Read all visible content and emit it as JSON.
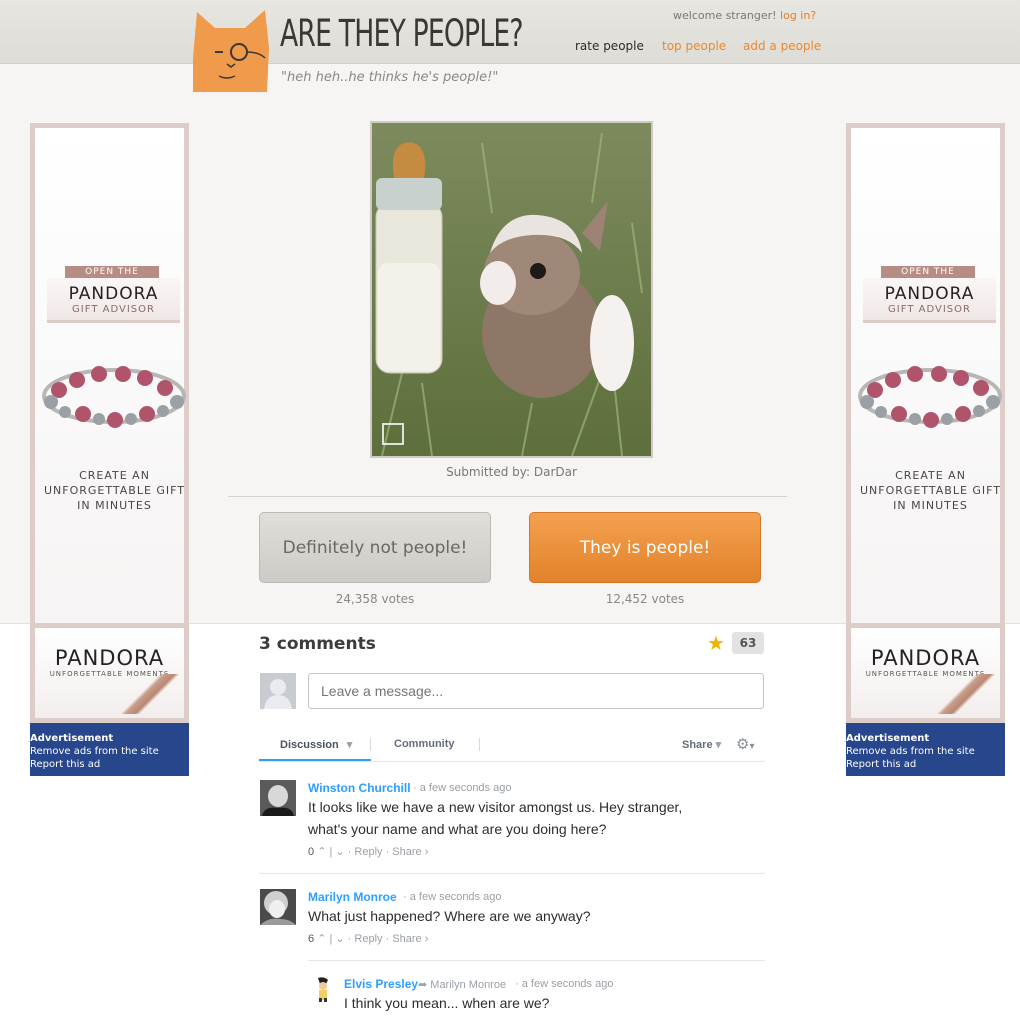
{
  "header": {
    "title": "ARE THEY PEOPLE?",
    "tagline": "\"heh heh..he thinks he's people!\"",
    "welcome_text": "welcome stranger!",
    "login_link": "log in?",
    "nav": {
      "rate": "rate people",
      "top": "top people",
      "add": "add a people"
    }
  },
  "ad": {
    "open_the": "OPEN THE",
    "brand": "PANDORA",
    "gift_advisor": "GIFT ADVISOR",
    "create_line1": "CREATE AN",
    "create_line2": "UNFORGETTABLE GIFT",
    "create_line3": "IN MINUTES",
    "logo_brand": "PANDORA",
    "moments": "UNFORGETTABLE MOMENTS",
    "advertisement": "Advertisement",
    "remove_ads": "Remove ads from the site",
    "report": "Report this ad"
  },
  "submission": {
    "submitted_by": "Submitted by: DarDar"
  },
  "voting": {
    "not_label": "Definitely not people!",
    "not_votes": "24,358 votes",
    "people_label": "They is people!",
    "people_votes": "12,452 votes"
  },
  "comments": {
    "count_label": "3 comments",
    "star_count": "63",
    "input_placeholder": "Leave a message...",
    "tabs": {
      "discussion": "Discussion",
      "community": "Community",
      "share": "Share"
    },
    "items": [
      {
        "author": "Winston Churchill",
        "time": "a few seconds ago",
        "text_line1": "It looks like we have a new visitor amongst us. Hey stranger,",
        "text_line2": "what's your name and what are you doing here?",
        "votes": "0",
        "reply": "Reply",
        "share": "Share"
      },
      {
        "author": "Marilyn Monroe",
        "time": "a few seconds ago",
        "text_line1": "What just happened? Where are we anyway?",
        "votes": "6",
        "reply": "Reply",
        "share": "Share"
      },
      {
        "author": "Elvis Presley",
        "reply_to": "Marilyn Monroe",
        "time": "a few seconds ago",
        "text_line1": "I think you mean... when are we?"
      }
    ]
  },
  "colors": {
    "accent_orange": "#e9892f",
    "disqus_blue": "#2e9fff",
    "ad_blue": "#27468c"
  }
}
